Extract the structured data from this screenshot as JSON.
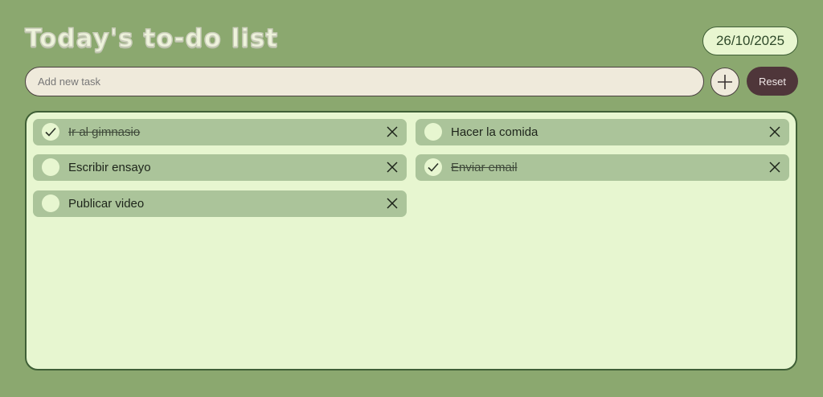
{
  "header": {
    "title": "Today's to-do list",
    "date": "26/10/2025"
  },
  "new_task": {
    "placeholder": "Add new task",
    "value": "",
    "add_icon": "plus-icon",
    "reset_label": "Reset"
  },
  "tasks": [
    {
      "label": "Ir al gimnasio",
      "done": true
    },
    {
      "label": "Hacer la comida",
      "done": false
    },
    {
      "label": "Escribir ensayo",
      "done": false
    },
    {
      "label": "Enviar email",
      "done": true
    },
    {
      "label": "Publicar video",
      "done": false
    }
  ],
  "colors": {
    "background": "#8ba86f",
    "panel": "#e7f6d0",
    "task_row": "#abc49a",
    "reset_button": "#4f363a",
    "border": "#3f5f36"
  }
}
